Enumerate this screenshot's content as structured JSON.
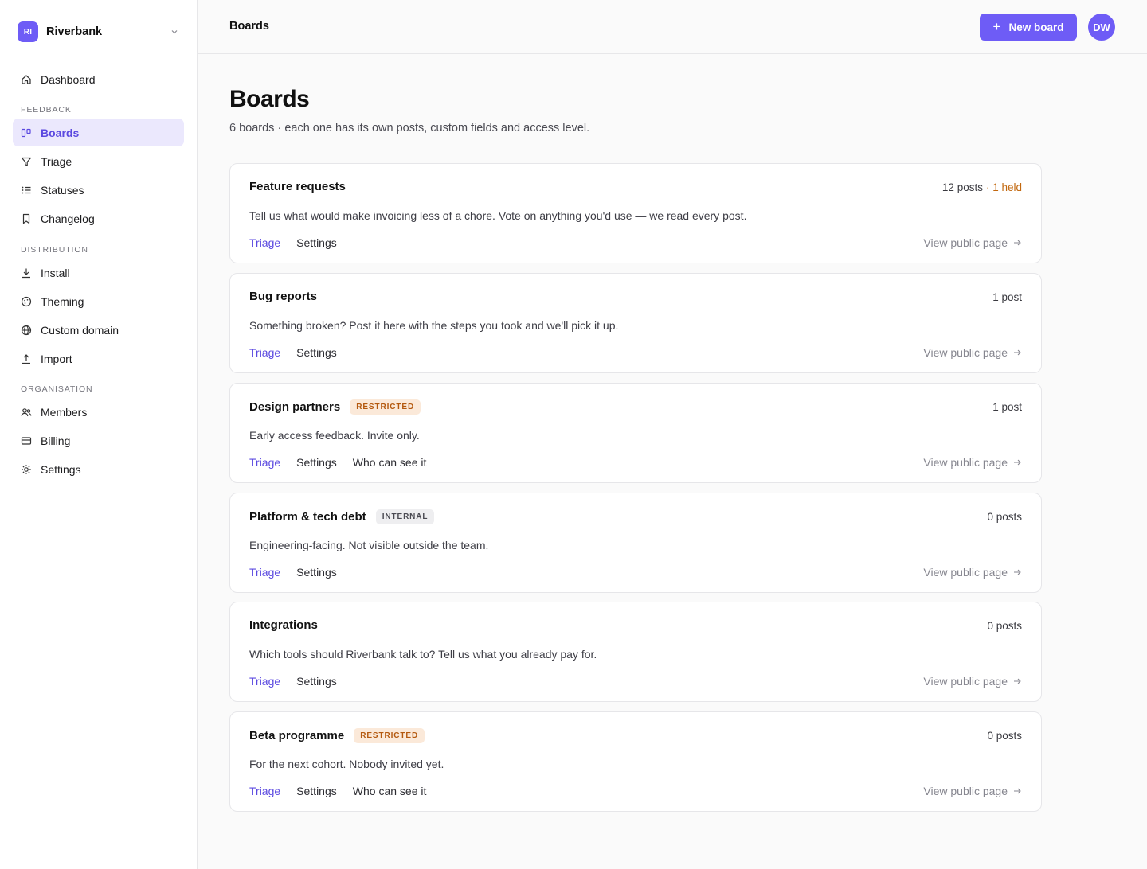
{
  "workspace": {
    "initials": "RI",
    "name": "Riverbank"
  },
  "nav": {
    "dashboard": "Dashboard",
    "feedback_section": "FEEDBACK",
    "boards": "Boards",
    "triage": "Triage",
    "statuses": "Statuses",
    "changelog": "Changelog",
    "distribution_section": "DISTRIBUTION",
    "install": "Install",
    "theming": "Theming",
    "custom_domain": "Custom domain",
    "import": "Import",
    "organisation_section": "ORGANISATION",
    "members": "Members",
    "billing": "Billing",
    "settings": "Settings"
  },
  "topbar": {
    "breadcrumb": "Boards",
    "new_board_label": "New board",
    "avatar_initials": "DW"
  },
  "page": {
    "title": "Boards",
    "subtitle": "6 boards · each one has its own posts, custom fields and access level."
  },
  "boards": [
    {
      "name": "Feature requests",
      "badge": "",
      "count": "12 posts",
      "held": "· 1 held",
      "description": "Tell us what would make invoicing less of a chore. Vote on anything you'd use — we read every post.",
      "triage": "Triage",
      "settings": "Settings",
      "access": "",
      "view": "View public page"
    },
    {
      "name": "Bug reports",
      "badge": "",
      "count": "1 post",
      "held": "",
      "description": "Something broken? Post it here with the steps you took and we'll pick it up.",
      "triage": "Triage",
      "settings": "Settings",
      "access": "",
      "view": "View public page"
    },
    {
      "name": "Design partners",
      "badge": "RESTRICTED",
      "count": "1 post",
      "held": "",
      "description": "Early access feedback. Invite only.",
      "triage": "Triage",
      "settings": "Settings",
      "access": "Who can see it",
      "view": "View public page"
    },
    {
      "name": "Platform & tech debt",
      "badge": "INTERNAL",
      "count": "0 posts",
      "held": "",
      "description": "Engineering-facing. Not visible outside the team.",
      "triage": "Triage",
      "settings": "Settings",
      "access": "",
      "view": "View public page"
    },
    {
      "name": "Integrations",
      "badge": "",
      "count": "0 posts",
      "held": "",
      "description": "Which tools should Riverbank talk to? Tell us what you already pay for.",
      "triage": "Triage",
      "settings": "Settings",
      "access": "",
      "view": "View public page"
    },
    {
      "name": "Beta programme",
      "badge": "RESTRICTED",
      "count": "0 posts",
      "held": "",
      "description": "For the next cohort. Nobody invited yet.",
      "triage": "Triage",
      "settings": "Settings",
      "access": "Who can see it",
      "view": "View public page"
    }
  ],
  "colors": {
    "accent": "#6e5cf6",
    "active_bg": "#ebe8fd",
    "held": "#c2680f",
    "restricted_bg": "#fbe9d9",
    "restricted_fg": "#b4590f"
  }
}
